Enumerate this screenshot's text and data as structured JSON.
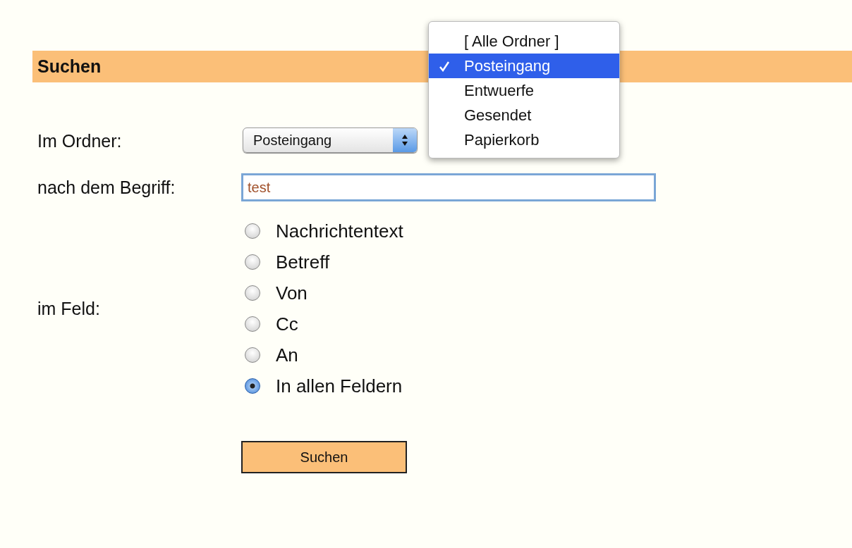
{
  "header": {
    "title": "Suchen"
  },
  "form": {
    "folder": {
      "label": "Im Ordner:",
      "value": "Posteingang"
    },
    "term": {
      "label": "nach dem Begriff:",
      "value": "test"
    },
    "field": {
      "label": "im Feld:",
      "options": [
        {
          "label": "Nachrichtentext",
          "selected": false
        },
        {
          "label": "Betreff",
          "selected": false
        },
        {
          "label": "Von",
          "selected": false
        },
        {
          "label": "Cc",
          "selected": false
        },
        {
          "label": "An",
          "selected": false
        },
        {
          "label": "In allen Feldern",
          "selected": true
        }
      ]
    },
    "submit": "Suchen"
  },
  "folder_menu": {
    "items": [
      {
        "label": "[ Alle Ordner ]",
        "selected": false
      },
      {
        "label": "Posteingang",
        "selected": true
      },
      {
        "label": "Entwuerfe",
        "selected": false
      },
      {
        "label": "Gesendet",
        "selected": false
      },
      {
        "label": "Papierkorb",
        "selected": false
      }
    ]
  }
}
